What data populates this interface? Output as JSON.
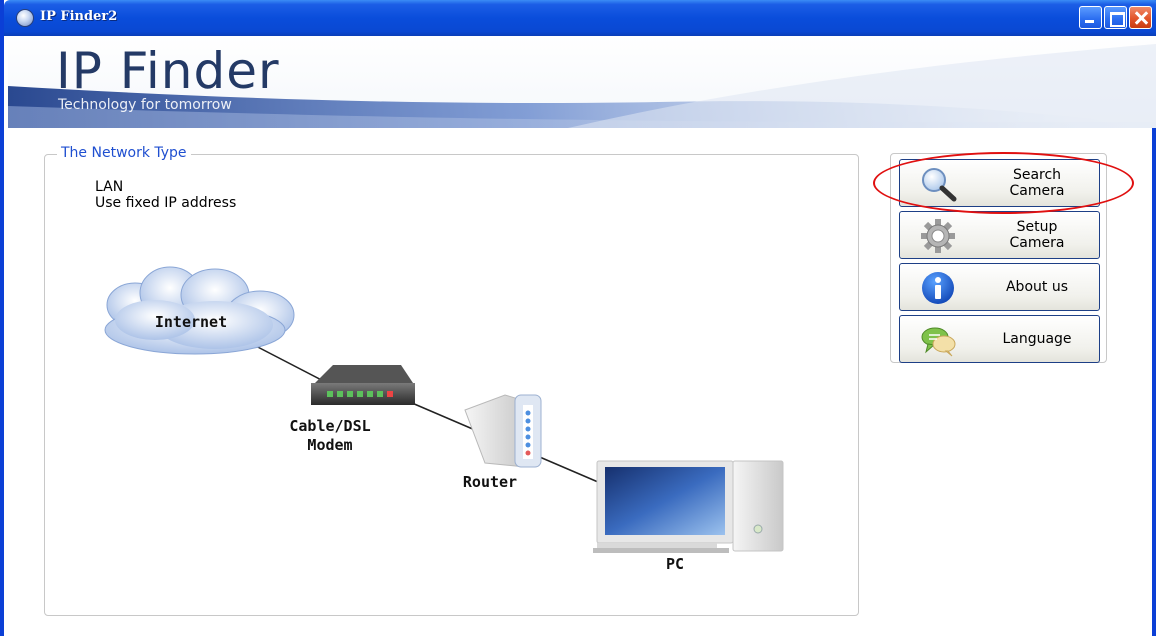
{
  "window": {
    "title": "IP Finder2",
    "controls": {
      "minimize": "minimize-icon",
      "maximize": "maximize-icon",
      "close": "close-icon"
    }
  },
  "banner": {
    "brand": "IP Finder",
    "tagline": "Technology for tomorrow"
  },
  "network": {
    "group_title": "The Network Type",
    "type": "LAN",
    "mode": "Use fixed IP address",
    "diagram": {
      "internet": "Internet",
      "modem_line1": "Cable/DSL",
      "modem_line2": "Modem",
      "router": "Router",
      "pc": "PC"
    }
  },
  "actions": {
    "search": {
      "line1": "Search",
      "line2": "Camera",
      "icon": "magnifier-icon"
    },
    "setup": {
      "line1": "Setup",
      "line2": "Camera",
      "icon": "gear-icon"
    },
    "about": {
      "label": "About us",
      "icon": "info-icon"
    },
    "language": {
      "label": "Language",
      "icon": "chat-bubbles-icon"
    }
  },
  "annotation": {
    "highlight_color": "#e01010"
  },
  "colors": {
    "titlebar": "#0a4ddb",
    "legend_text": "#1f4fd0",
    "brand_text": "#243a66"
  }
}
